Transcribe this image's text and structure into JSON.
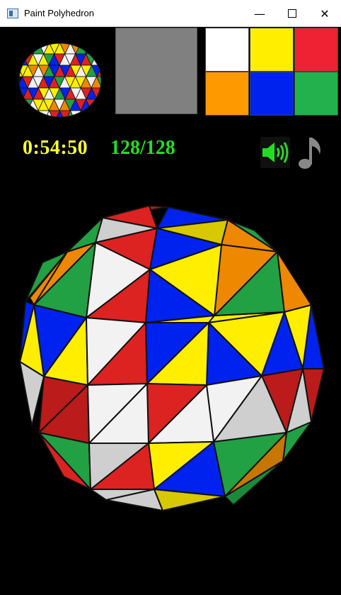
{
  "window": {
    "title": "Paint Polyhedron",
    "min_icon": "—",
    "max_icon": "restore",
    "close_icon": "✕"
  },
  "palette": {
    "current_color": "#808080",
    "colors": [
      "#ffffff",
      "#ffee00",
      "#ee2233",
      "#ff9900",
      "#0022ee",
      "#22b14c"
    ]
  },
  "status": {
    "timer": "0:54:50",
    "progress": "128/128"
  },
  "controls": {
    "sound_icon": "speaker-icon",
    "music_icon": "music-note-icon"
  },
  "colors": {
    "timer": "#ffff33",
    "counter": "#22dd22",
    "sound": "#22dd22",
    "music": "#888888"
  }
}
